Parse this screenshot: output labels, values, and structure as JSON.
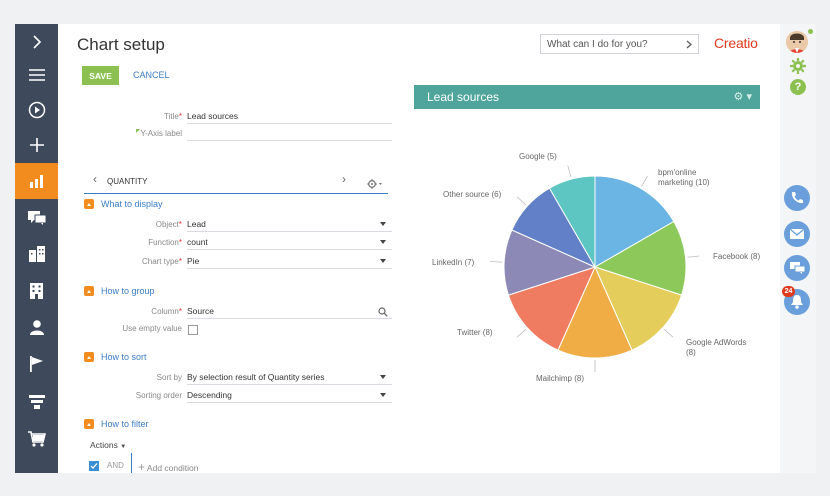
{
  "page": {
    "title": "Chart setup"
  },
  "header": {
    "search_placeholder": "What can I do for you?",
    "logo_text": "Creatio"
  },
  "toolbar": {
    "save_label": "SAVE",
    "cancel_label": "CANCEL"
  },
  "fields": {
    "title": {
      "label": "Title",
      "value": "Lead sources"
    },
    "y_axis": {
      "label": "Y-Axis label",
      "value": ""
    }
  },
  "series_tab": {
    "label": "QUANTITY"
  },
  "sections": {
    "what_to_display": {
      "title": "What to display",
      "object": {
        "label": "Object",
        "value": "Lead"
      },
      "function": {
        "label": "Function",
        "value": "count"
      },
      "chart_type": {
        "label": "Chart type",
        "value": "Pie"
      }
    },
    "how_to_group": {
      "title": "How to group",
      "column": {
        "label": "Column",
        "value": "Source"
      },
      "use_empty": {
        "label": "Use empty value"
      }
    },
    "how_to_sort": {
      "title": "How to sort",
      "sort_by": {
        "label": "Sort by",
        "value": "By selection result of Quantity series"
      },
      "sorting_order": {
        "label": "Sorting order",
        "value": "Descending"
      }
    },
    "how_to_filter": {
      "title": "How to filter",
      "actions_label": "Actions",
      "and_label": "AND",
      "add_condition_label": "Add condition"
    }
  },
  "notifications_count": "24",
  "chart_data": {
    "type": "pie",
    "title": "Lead sources",
    "slices": [
      {
        "label": "bpm'online marketing",
        "value": 10,
        "color": "#6ab5e4"
      },
      {
        "label": "Facebook",
        "value": 8,
        "color": "#8cc95a"
      },
      {
        "label": "Google AdWords",
        "value": 8,
        "color": "#e4cd5b"
      },
      {
        "label": "Mailchimp",
        "value": 8,
        "color": "#f0ad45"
      },
      {
        "label": "Twitter",
        "value": 8,
        "color": "#ef7b60"
      },
      {
        "label": "LinkedIn",
        "value": 7,
        "color": "#8c89b6"
      },
      {
        "label": "Other source",
        "value": 6,
        "color": "#6180c8"
      },
      {
        "label": "Google",
        "value": 5,
        "color": "#5dc6c2"
      }
    ],
    "slice_labels": [
      "bpm'online marketing (10)",
      "Facebook (8)",
      "Google AdWords (8)",
      "Mailchimp (8)",
      "Twitter (8)",
      "LinkedIn (7)",
      "Other source (6)",
      "Google (5)"
    ]
  },
  "colors": {
    "accent": "#f28c1e",
    "nav_bg": "#3e4a5c",
    "chart_header": "#4fa59b",
    "link": "#3b7dc4",
    "save": "#8cc152"
  }
}
